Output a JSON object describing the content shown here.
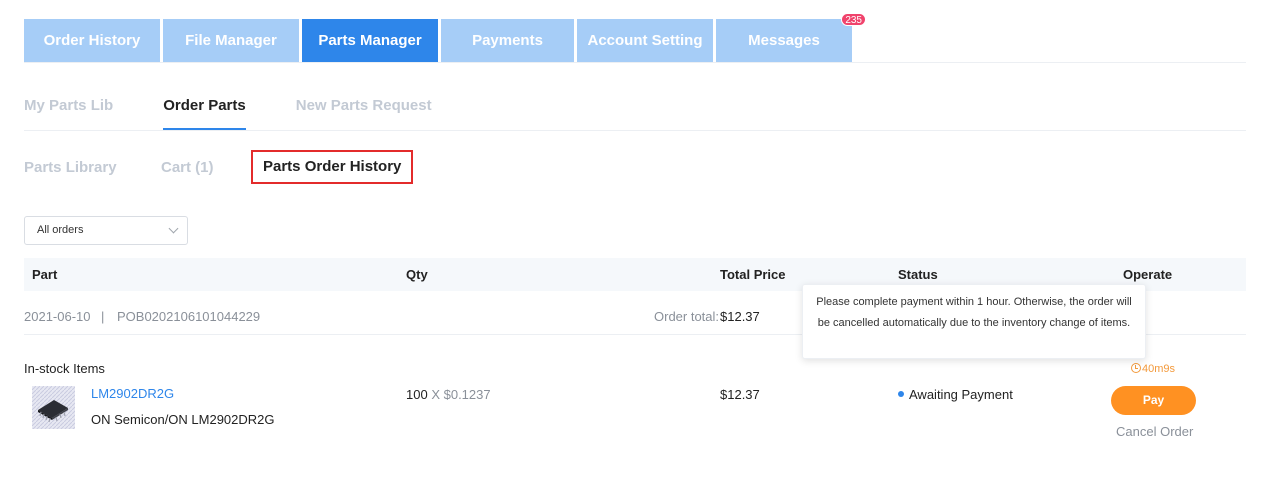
{
  "top_tabs": [
    {
      "label": "Order History"
    },
    {
      "label": "File Manager"
    },
    {
      "label": "Parts Manager"
    },
    {
      "label": "Payments"
    },
    {
      "label": "Account Setting"
    },
    {
      "label": "Messages",
      "badge": "235"
    }
  ],
  "sub_tabs": [
    {
      "label": "My Parts Lib"
    },
    {
      "label": "Order Parts"
    },
    {
      "label": "New Parts Request"
    }
  ],
  "third_tabs": [
    {
      "label": "Parts Library"
    },
    {
      "label": "Cart (1)"
    },
    {
      "label": "Parts Order History"
    }
  ],
  "filter": {
    "selected": "All orders"
  },
  "table": {
    "headers": {
      "part": "Part",
      "qty": "Qty",
      "total": "Total Price",
      "status": "Status",
      "operate": "Operate"
    }
  },
  "order": {
    "date": "2021-06-10",
    "separator": "|",
    "number": "POB0202106101044229",
    "total_label": "Order total:",
    "total_value": "$12.37",
    "group": "In-stock Items",
    "item": {
      "part_number": "LM2902DR2G",
      "manufacturer": "ON Semicon/ON LM2902DR2G",
      "qty": "100",
      "unit_price": "X $0.1237",
      "price": "$12.37",
      "status": "Awaiting Payment",
      "timer": "40m9s",
      "pay_label": "Pay",
      "cancel_label": "Cancel Order"
    }
  },
  "tooltip": {
    "text": "Please complete payment within 1 hour. Otherwise, the order will be cancelled automatically due to the inventory change of items."
  },
  "colors": {
    "primary": "#2e86ea",
    "tab_inactive": "#a6cdf7",
    "pay": "#ff9122",
    "badge": "#f0436c",
    "highlight": "#e32b2b",
    "timer": "#f39a3c"
  }
}
